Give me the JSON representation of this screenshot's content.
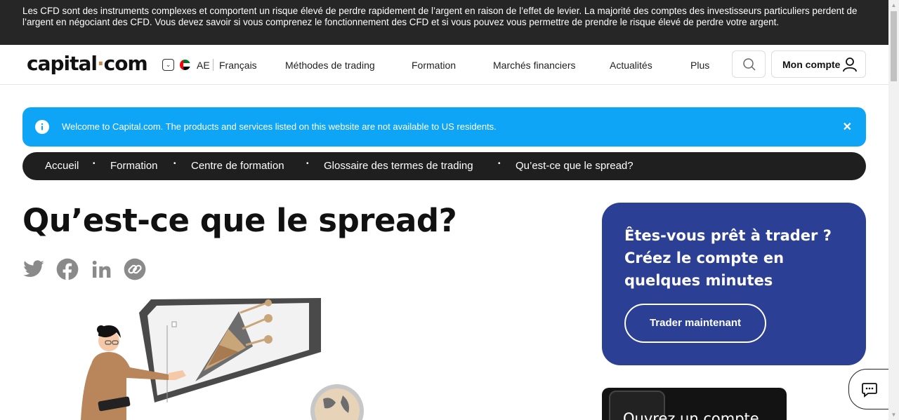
{
  "risk_warning": "Les CFD sont des instruments complexes et comportent un risque élevé de perdre rapidement de l’argent en raison de l’effet de levier. La majorité des comptes des investisseurs particuliers perdent de l’argent en négociant des CFD. Vous devez savoir si vous comprenez le fonctionnement des CFD et si vous pouvez vous permettre de prendre le risque élevé de perdre votre argent.",
  "header": {
    "logo_left": "capital",
    "logo_dot": "·",
    "logo_right": "com",
    "region": "AE",
    "language": "Français",
    "nav": [
      "Méthodes de trading",
      "Formation",
      "Marchés financiers",
      "Actualités",
      "Plus"
    ],
    "account_label": "Mon compte"
  },
  "info_banner": {
    "text": "Welcome to Capital.com. The products and services listed on this website are not available to US residents.",
    "close": "✕"
  },
  "breadcrumb": [
    "Accueil",
    "Formation",
    "Centre de formation",
    "Glossaire des termes de trading",
    "Qu’est-ce que le spread?"
  ],
  "breadcrumb_sep": "•",
  "page_title": "Qu’est-ce que le spread?",
  "cta": {
    "title": "Êtes-vous prêt à trader ? Créez le compte en quelques minutes",
    "button": "Trader maintenant"
  },
  "promo_card": {
    "text": "Ouvrez un compte"
  },
  "colors": {
    "risk_bg": "#262626",
    "info_bg": "#0ea5f7",
    "breadcrumb_bg": "#1f1f1f",
    "cta_bg": "#2b3f94",
    "logo_dot": "#c08a4f"
  },
  "icons": {
    "share": [
      "twitter-icon",
      "facebook-icon",
      "linkedin-icon",
      "copy-link-icon"
    ],
    "search": "search-icon",
    "account": "user-icon",
    "info": "info-icon",
    "chat": "chat-icon"
  }
}
